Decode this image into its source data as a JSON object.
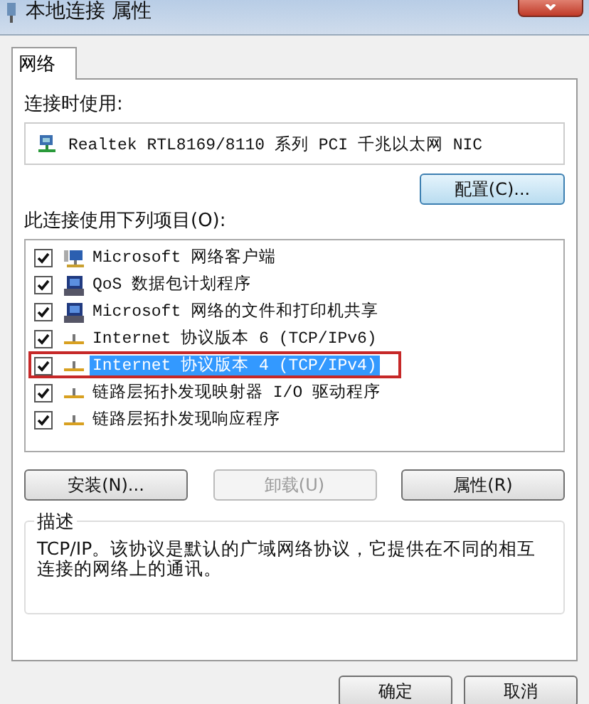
{
  "window": {
    "title": "本地连接 属性"
  },
  "tabs": [
    {
      "label": "网络",
      "selected": true
    }
  ],
  "connect_using": {
    "label": "连接时使用:",
    "adapter": "Realtek RTL8169/8110 系列 PCI 千兆以太网 NIC",
    "configure_button": "配置(C)..."
  },
  "items_label": "此连接使用下列项目(O):",
  "items": [
    {
      "label": "Microsoft 网络客户端",
      "checked": true,
      "selected": false,
      "kind": "client"
    },
    {
      "label": "QoS 数据包计划程序",
      "checked": true,
      "selected": false,
      "kind": "service"
    },
    {
      "label": "Microsoft 网络的文件和打印机共享",
      "checked": true,
      "selected": false,
      "kind": "service"
    },
    {
      "label": "Internet 协议版本 6 (TCP/IPv6)",
      "checked": true,
      "selected": false,
      "kind": "protocol"
    },
    {
      "label": "Internet 协议版本 4 (TCP/IPv4)",
      "checked": true,
      "selected": true,
      "kind": "protocol"
    },
    {
      "label": "链路层拓扑发现映射器 I/O 驱动程序",
      "checked": true,
      "selected": false,
      "kind": "protocol"
    },
    {
      "label": "链路层拓扑发现响应程序",
      "checked": true,
      "selected": false,
      "kind": "protocol"
    }
  ],
  "item_buttons": [
    {
      "label": "安装(N)...",
      "disabled": false
    },
    {
      "label": "卸载(U)",
      "disabled": true
    },
    {
      "label": "属性(R)",
      "disabled": false
    }
  ],
  "description": {
    "title": "描述",
    "text": "TCP/IP。该协议是默认的广域网络协议，它提供在不同的相互连接的网络上的通讯。"
  },
  "footer_buttons": [
    "确定",
    "取消"
  ]
}
